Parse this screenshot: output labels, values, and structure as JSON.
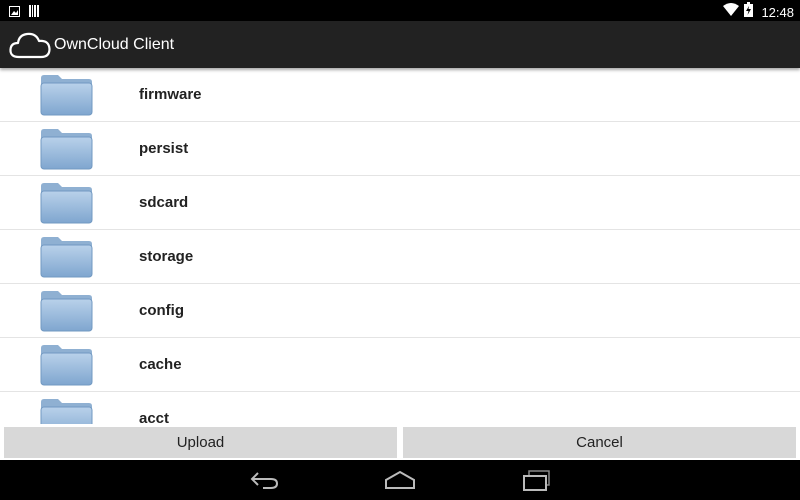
{
  "status_bar": {
    "time": "12:48",
    "icons": [
      "image-notification-icon",
      "barcode-notification-icon",
      "wifi-icon",
      "battery-charging-icon"
    ]
  },
  "action_bar": {
    "title": "OwnCloud Client",
    "icon": "cloud-icon"
  },
  "folders": [
    {
      "name": "firmware",
      "icon": "folder-icon"
    },
    {
      "name": "persist",
      "icon": "folder-icon"
    },
    {
      "name": "sdcard",
      "icon": "folder-icon"
    },
    {
      "name": "storage",
      "icon": "folder-icon"
    },
    {
      "name": "config",
      "icon": "folder-icon"
    },
    {
      "name": "cache",
      "icon": "folder-icon"
    },
    {
      "name": "acct",
      "icon": "folder-icon"
    }
  ],
  "buttons": {
    "upload_label": "Upload",
    "cancel_label": "Cancel"
  },
  "nav_bar": {
    "icons": [
      "back-icon",
      "home-icon",
      "recents-icon"
    ]
  },
  "colors": {
    "status_bar": "#000000",
    "action_bar": "#222222",
    "button_bg": "#d8d8d8",
    "folder_blue": "#8fb3d6"
  }
}
